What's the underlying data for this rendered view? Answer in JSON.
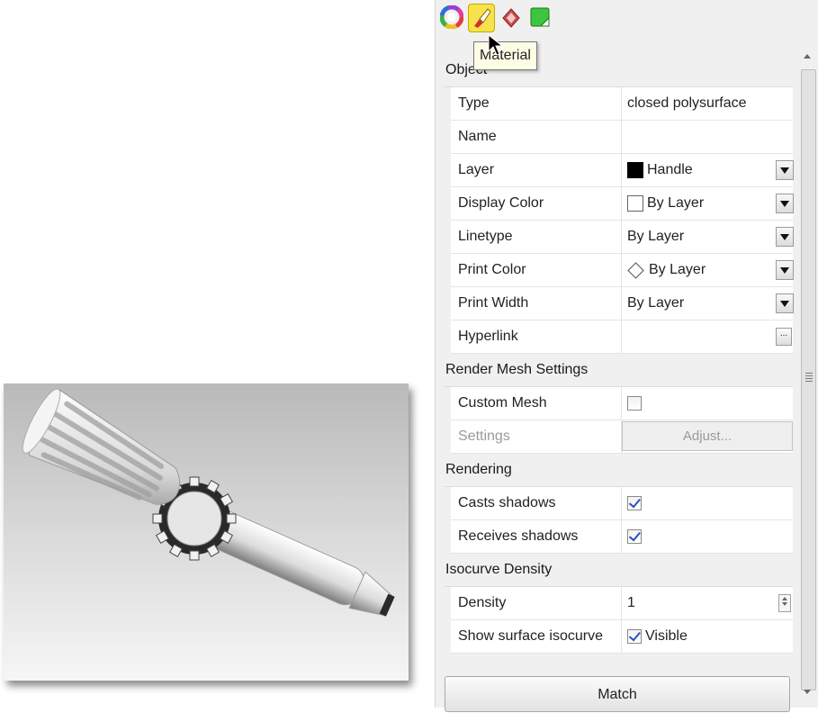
{
  "tooltip": "Material",
  "tabs": [
    {
      "icon": "object-color-wheel-icon"
    },
    {
      "icon": "material-brush-icon",
      "active": true
    },
    {
      "icon": "texture-map-icon"
    },
    {
      "icon": "decal-icon"
    }
  ],
  "sections": {
    "object": "Object",
    "render_mesh": "Render Mesh Settings",
    "rendering": "Rendering",
    "isocurve": "Isocurve Density"
  },
  "properties": {
    "type": {
      "label": "Type",
      "value": "closed polysurface"
    },
    "name": {
      "label": "Name",
      "value": ""
    },
    "layer": {
      "label": "Layer",
      "value": "Handle"
    },
    "display_color": {
      "label": "Display Color",
      "value": "By Layer"
    },
    "linetype": {
      "label": "Linetype",
      "value": "By Layer"
    },
    "print_color": {
      "label": "Print Color",
      "value": "By Layer"
    },
    "print_width": {
      "label": "Print Width",
      "value": "By Layer"
    },
    "hyperlink": {
      "label": "Hyperlink",
      "value": "",
      "button": "..."
    }
  },
  "render_mesh": {
    "custom_mesh": {
      "label": "Custom Mesh",
      "checked": false
    },
    "settings": {
      "label": "Settings",
      "button": "Adjust..."
    }
  },
  "rendering": {
    "casts_shadows": {
      "label": "Casts shadows",
      "checked": true
    },
    "receives_shadows": {
      "label": "Receives shadows",
      "checked": true
    }
  },
  "isocurve": {
    "density": {
      "label": "Density",
      "value": "1"
    },
    "show_surface_isocurve": {
      "label": "Show surface isocurve",
      "checked": true,
      "value": "Visible"
    }
  },
  "match_button": "Match",
  "colors": {
    "layer_swatch": "#000000",
    "tab_active": "#f6e24a",
    "checkbox_tick": "#2a4fbf"
  }
}
